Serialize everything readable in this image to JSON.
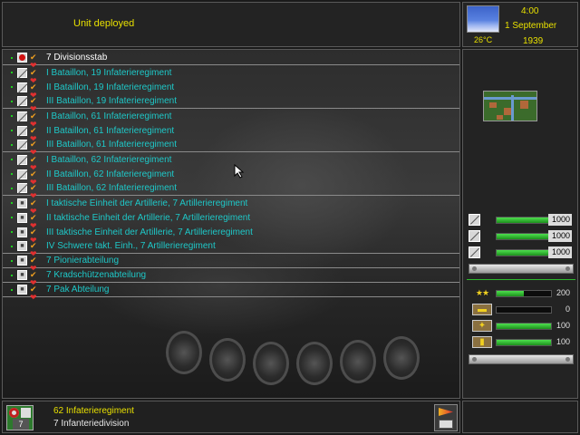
{
  "header": {
    "status": "Unit deployed"
  },
  "datebox": {
    "time": "4:00",
    "date": "1 September",
    "year": "1939",
    "temperature": "26°C",
    "weather_icon": "sky-icon"
  },
  "units": [
    {
      "name": "7 Divisionsstab",
      "icon": "hq",
      "selected": true,
      "sep": true
    },
    {
      "name": "I Bataillon, 19 Infaterieregiment",
      "icon": "inf"
    },
    {
      "name": "II Bataillon, 19 Infaterieregiment",
      "icon": "inf"
    },
    {
      "name": "III Bataillon, 19 Infaterieregiment",
      "icon": "inf",
      "sep": true
    },
    {
      "name": "I Bataillon, 61 Infaterieregiment",
      "icon": "inf"
    },
    {
      "name": "II Bataillon, 61 Infaterieregiment",
      "icon": "inf"
    },
    {
      "name": "III Bataillon, 61 Infaterieregiment",
      "icon": "inf",
      "sep": true
    },
    {
      "name": "I Bataillon, 62 Infaterieregiment",
      "icon": "inf"
    },
    {
      "name": "II Bataillon, 62 Infaterieregiment",
      "icon": "inf"
    },
    {
      "name": "III Bataillon, 62 Infaterieregiment",
      "icon": "inf",
      "sep": true
    },
    {
      "name": "I taktische Einheit der Artillerie, 7 Artillerieregiment",
      "icon": "art"
    },
    {
      "name": "II taktische Einheit der Artillerie, 7 Artillerieregiment",
      "icon": "art"
    },
    {
      "name": "III taktische Einheit der Artillerie, 7 Artillerieregiment",
      "icon": "art"
    },
    {
      "name": "IV Schwere takt. Einh., 7  Artillerieregiment",
      "icon": "art",
      "sep": true
    },
    {
      "name": "7 Pionierabteilung",
      "icon": "art",
      "sep": true
    },
    {
      "name": "7 Kradschützenabteilung",
      "icon": "art",
      "sep": true
    },
    {
      "name": "7 Pak Abteilung",
      "icon": "art",
      "sep": true
    }
  ],
  "strength_bars": [
    {
      "value": "1000",
      "fill": 1.0
    },
    {
      "value": "1000",
      "fill": 1.0
    },
    {
      "value": "1000",
      "fill": 1.0
    }
  ],
  "stats": [
    {
      "icon": "stars-icon",
      "value": "200",
      "fill": 0.5
    },
    {
      "icon": "tank-icon",
      "value": "0",
      "fill": 0.0
    },
    {
      "icon": "supply-icon",
      "value": "100",
      "fill": 1.0
    },
    {
      "icon": "ammo-icon",
      "value": "100",
      "fill": 1.0
    }
  ],
  "footer": {
    "regiment": "62 Infaterieregiment",
    "division": "7 Infanteriedivision",
    "badge_number": "7"
  },
  "colors": {
    "unit_text": "#1ec8c8",
    "highlight": "#e8e000",
    "bar": "#2eb82e"
  }
}
